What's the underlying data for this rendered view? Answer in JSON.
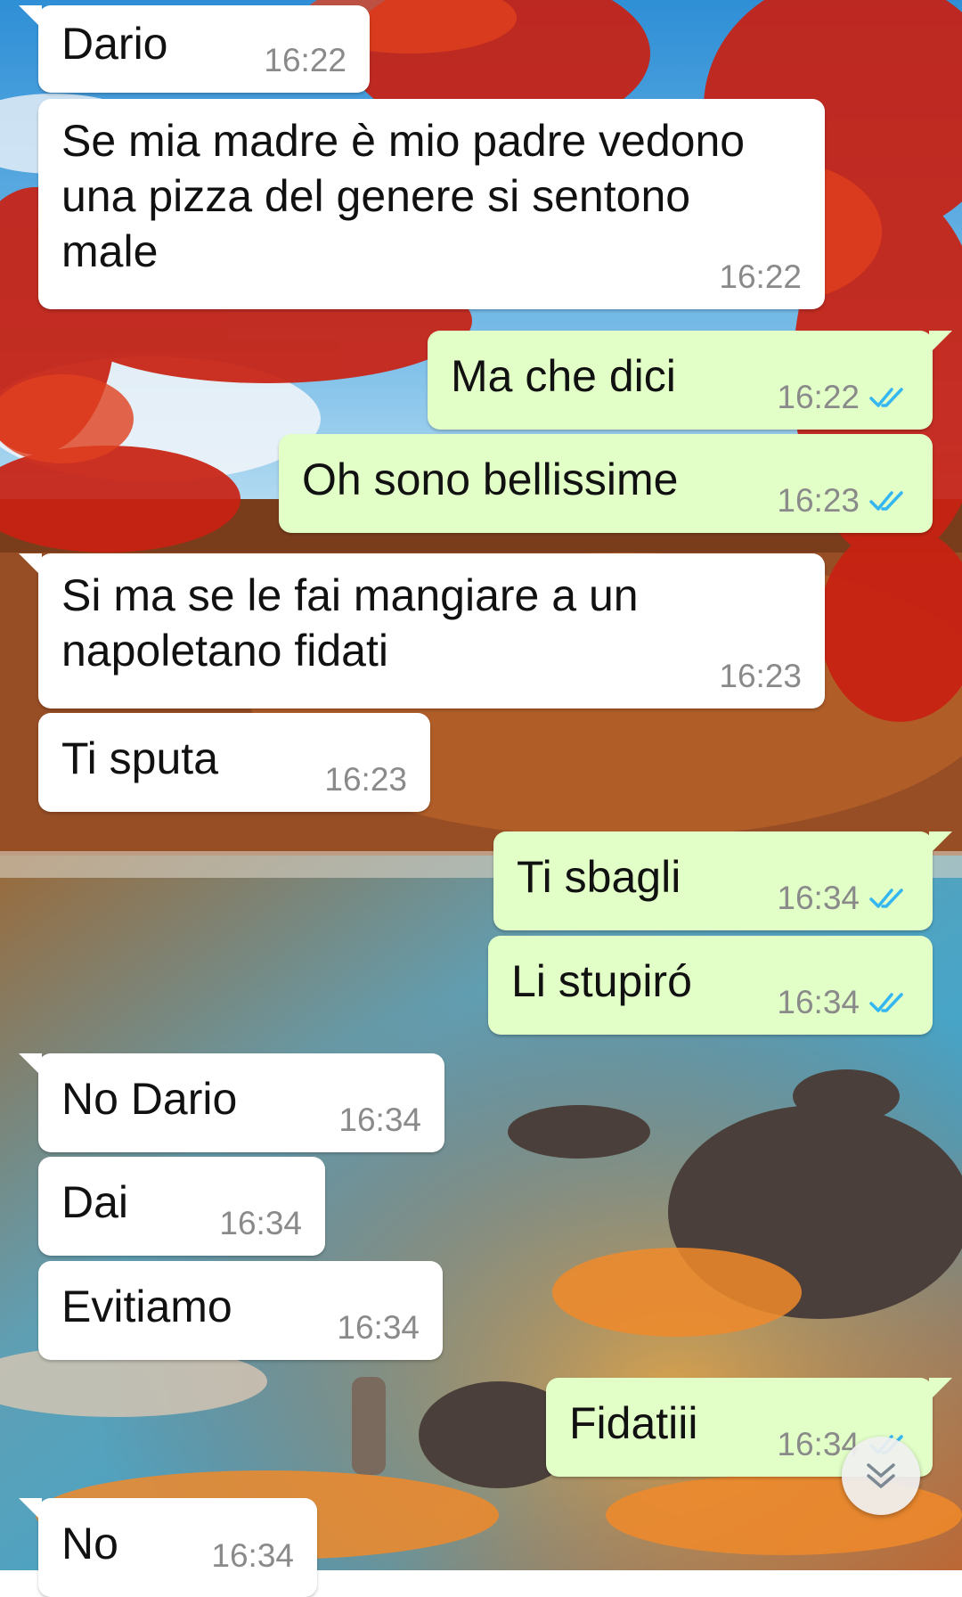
{
  "messages": [
    {
      "dir": "in",
      "text": "Dario",
      "time": "16:22"
    },
    {
      "dir": "in",
      "text": "Se mia madre è mio padre vedono\nuna pizza del genere si sentono\nmale",
      "time": "16:22"
    },
    {
      "dir": "out",
      "text": "Ma che dici",
      "time": "16:22",
      "status": "read"
    },
    {
      "dir": "out",
      "text": "Oh sono bellissime",
      "time": "16:23",
      "status": "read"
    },
    {
      "dir": "in",
      "text": "Si ma se le fai mangiare a un\nnapoletano fidati",
      "time": "16:23"
    },
    {
      "dir": "in",
      "text": "Ti sputa",
      "time": "16:23"
    },
    {
      "dir": "out",
      "text": "Ti sbagli",
      "time": "16:34",
      "status": "read"
    },
    {
      "dir": "out",
      "text": "Li stupiró",
      "time": "16:34",
      "status": "read"
    },
    {
      "dir": "in",
      "text": "No Dario",
      "time": "16:34"
    },
    {
      "dir": "in",
      "text": "Dai",
      "time": "16:34"
    },
    {
      "dir": "in",
      "text": "Evitiamo",
      "time": "16:34"
    },
    {
      "dir": "out",
      "text": "Fidatiii",
      "time": "16:34",
      "status": "read"
    },
    {
      "dir": "in",
      "text": "No",
      "time": "16:34"
    }
  ],
  "colors": {
    "incoming_bubble": "#ffffff",
    "outgoing_bubble": "#e2ffc8",
    "read_ticks": "#34b7f1",
    "timestamp": "#8a8a8a"
  },
  "icons": {
    "read_status": "double-check-icon",
    "scroll_down": "double-chevron-down-icon"
  }
}
